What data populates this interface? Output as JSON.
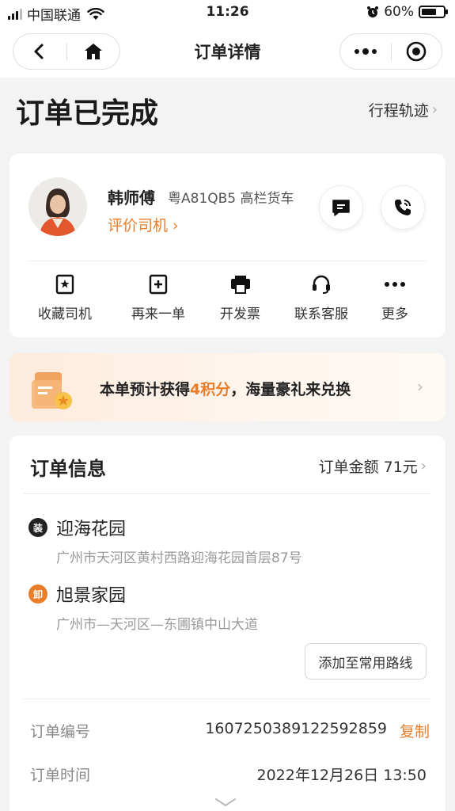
{
  "status_bar": {
    "carrier": "中国联通",
    "time": "11:26",
    "battery_text": "60%",
    "battery_level": 0.6,
    "icons": [
      "signal-icon",
      "wifi-icon",
      "alarm-icon",
      "battery-icon"
    ]
  },
  "nav": {
    "title": "订单详情",
    "left_icons": [
      "back-icon",
      "home-icon"
    ],
    "right_icons": [
      "more-icon",
      "record-icon"
    ]
  },
  "order_status": {
    "title": "订单已完成",
    "track_link": "行程轨迹"
  },
  "driver": {
    "name": "韩师傅",
    "plate_vehicle": "粤A81QB5 高栏货车",
    "rate_link": "评价司机 ›",
    "buttons": [
      "message-icon",
      "phone-icon"
    ]
  },
  "actions": [
    {
      "label": "收藏司机",
      "icon": "bookmark-star-icon"
    },
    {
      "label": "再来一单",
      "icon": "plus-square-icon"
    },
    {
      "label": "开发票",
      "icon": "invoice-printer-icon"
    },
    {
      "label": "联系客服",
      "icon": "headset-icon"
    },
    {
      "label": "更多",
      "icon": "more-dots-icon"
    }
  ],
  "points_banner": {
    "prefix": "本单预计获得",
    "highlight": "4积分",
    "suffix": "，海量豪礼来兑换",
    "accent_color": "#ea7d2a"
  },
  "order_info": {
    "title": "订单信息",
    "amount_text": "订单金额 71元",
    "pickup": {
      "badge": "装",
      "name": "迎海花园",
      "address": "广州市天河区黄村西路迎海花园首层87号",
      "badge_color": "#222222"
    },
    "dropoff": {
      "badge": "卸",
      "name": "旭景家园",
      "address": "广州市—天河区—东圃镇中山大道",
      "badge_color": "#ea7d2a"
    },
    "route_button": "添加至常用路线",
    "order_no_label": "订单编号",
    "order_no": "1607250389122592859",
    "copy_label": "复制",
    "order_time_label": "订单时间",
    "order_time": "2022年12月26日 13:50"
  }
}
